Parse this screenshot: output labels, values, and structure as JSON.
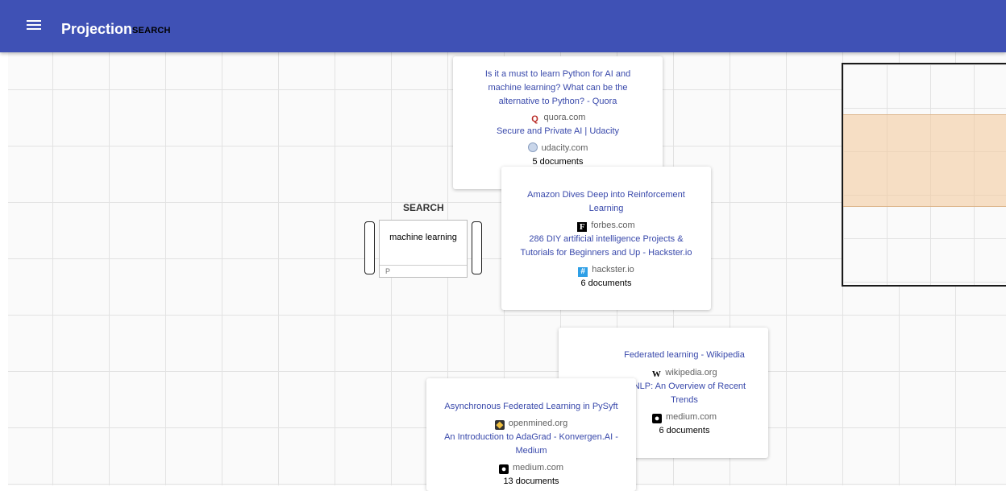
{
  "app": {
    "title": "Projection",
    "subtitle": "SEARCH"
  },
  "search": {
    "label": "SEARCH",
    "query": "machine learning",
    "footer": "P"
  },
  "cards": [
    {
      "items": [
        {
          "title": "Is it a must to learn Python for AI and machine learning? What can be the alternative to Python? - Quora",
          "domain": "quora.com",
          "icon": "quora-icon"
        },
        {
          "title": "Secure and Private AI | Udacity",
          "domain": "udacity.com",
          "icon": "globe-icon"
        }
      ],
      "docs": "5 documents"
    },
    {
      "items": [
        {
          "title": "Amazon Dives Deep into Reinforcement Learning",
          "domain": "forbes.com",
          "icon": "forbes-icon"
        },
        {
          "title": "286 DIY artificial intelligence Projects & Tutorials for Beginners and Up - Hackster.io",
          "domain": "hackster.io",
          "icon": "hackster-icon"
        }
      ],
      "docs": "6 documents"
    },
    {
      "items": [
        {
          "title": "Federated learning - Wikipedia",
          "domain": "wikipedia.org",
          "icon": "wikipedia-icon"
        },
        {
          "title": "or NLP: An Overview of Recent Trends",
          "domain": "medium.com",
          "icon": "medium-icon"
        }
      ],
      "docs": "6 documents"
    },
    {
      "items": [
        {
          "title": "Asynchronous Federated Learning in PySyft",
          "domain": "openmined.org",
          "icon": "openmined-icon"
        },
        {
          "title": "An Introduction to AdaGrad - Konvergen.AI - Medium",
          "domain": "medium.com",
          "icon": "medium-icon"
        }
      ],
      "docs": "13 documents"
    }
  ]
}
